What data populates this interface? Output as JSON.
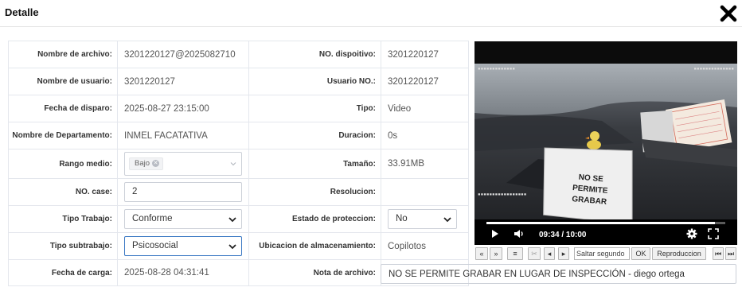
{
  "header": {
    "title": "Detalle",
    "close_icon": "close-x-icon"
  },
  "fields": {
    "file_name": {
      "label": "Nombre de archivo:",
      "value": "3201220127@2025082710"
    },
    "device_no": {
      "label": "NO. dispoitivo:",
      "value": "3201220127"
    },
    "user_name": {
      "label": "Nombre de usuario:",
      "value": "3201220127"
    },
    "user_no": {
      "label": "Usuario NO.:",
      "value": "3201220127"
    },
    "trigger_date": {
      "label": "Fecha de disparo:",
      "value": "2025-08-27 23:15:00"
    },
    "type": {
      "label": "Tipo:",
      "value": "Video"
    },
    "department": {
      "label": "Nombre de Departamento:",
      "value": "INMEL FACATATIVA"
    },
    "duration": {
      "label": "Duracion:",
      "value": "0s"
    },
    "range": {
      "label": "Rango medio:",
      "chip": "Bajo"
    },
    "size": {
      "label": "Tamaño:",
      "value": "33.91MB"
    },
    "case_no": {
      "label": "NO. case:",
      "value": "2"
    },
    "resolution": {
      "label": "Resolucion:",
      "value": ""
    },
    "work_type": {
      "label": "Tipo Trabajo:",
      "value": "Conforme"
    },
    "protection": {
      "label": "Estado de proteccion:",
      "value": "No"
    },
    "work_subtype": {
      "label": "Tipo subtrabajo:",
      "value": "Psicosocial"
    },
    "storage": {
      "label": "Ubicacion de almacenamiento:",
      "value": "Copilotos"
    },
    "upload_date": {
      "label": "Fecha de carga:",
      "value": "2025-08-28 04:31:41"
    },
    "file_note": {
      "label": "Nota de archivo:",
      "value": "NO SE PERMITE GRABAR EN LUGAR DE INSPECCIÓN - diego ortega"
    }
  },
  "video": {
    "sign_lines": [
      "NO SE",
      "PERMITE",
      "GRABAR"
    ],
    "time": "09:34 / 10:00",
    "progress_fraction": 0.957,
    "icons": [
      "play-icon",
      "volume-icon",
      "settings-gear-icon",
      "fullscreen-icon"
    ]
  },
  "toolbar": {
    "seek_placeholder": "Saltar segundo",
    "ok_label": "OK",
    "playback_label": "Reproduccion",
    "icons": [
      "rewind-icon",
      "fast-forward-icon",
      "list-icon",
      "cut-icon",
      "frame-back-icon",
      "frame-forward-icon",
      "first-page-icon",
      "last-page-icon"
    ]
  },
  "colors": {
    "border": "#e4e7ed",
    "input_border": "#ccd0d8",
    "video_bg": "#0c0c0c"
  }
}
